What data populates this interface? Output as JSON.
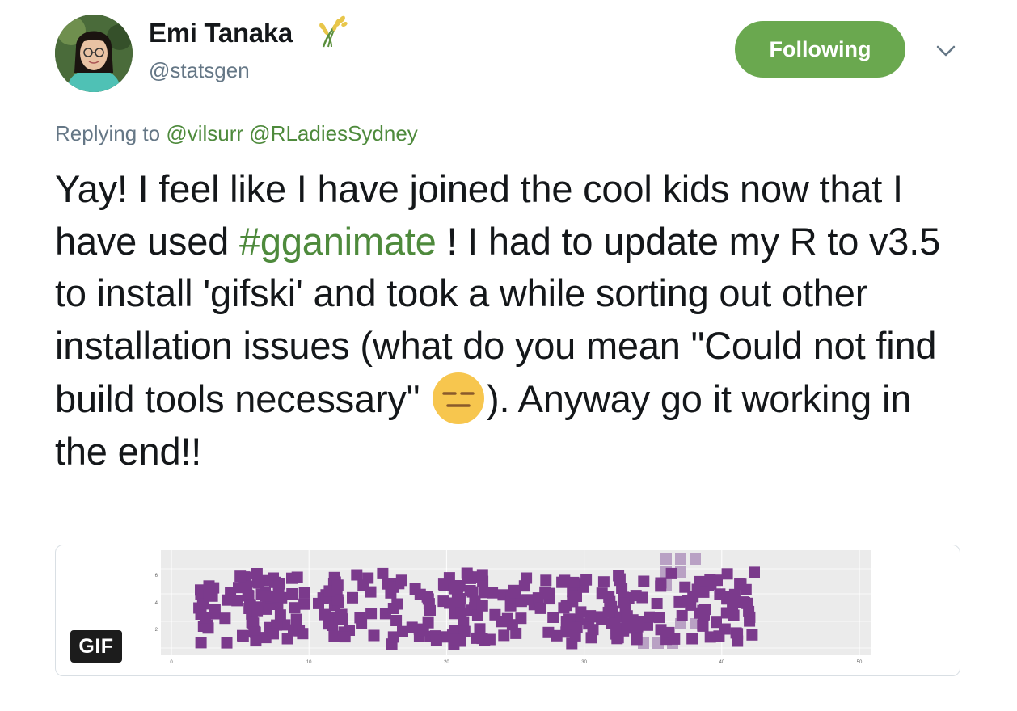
{
  "user": {
    "display_name": "Emi Tanaka",
    "handle": "@statsgen",
    "badge_icon": "rice-plant-icon"
  },
  "follow_button_label": "Following",
  "reply": {
    "prefix": "Replying to",
    "mentions": [
      "@vilsurr",
      "@RLadiesSydney"
    ]
  },
  "tweet": {
    "part1": "Yay! I feel like I have joined the cool kids now that I have used ",
    "hashtag": "#gganimate",
    "part2": " ! I had to update my R to v3.5 to install 'gifski' and took a while sorting out other installation issues (what do you mean \"Could not find build tools necessary\" ",
    "emoji": "expressionless-face-icon",
    "part3": "). Anyway go it working in the end!!"
  },
  "media": {
    "badge": "GIF",
    "accent_color": "#7b3a8c",
    "ghost_color": "#b9a1c4",
    "x_ticks": [
      "0",
      "10",
      "20",
      "30",
      "40",
      "50"
    ],
    "y_ticks": [
      "2",
      "4",
      "6"
    ]
  },
  "colors": {
    "link": "#4e8a3c",
    "button": "#6aa84f",
    "text": "#14171a",
    "secondary": "#657786"
  }
}
